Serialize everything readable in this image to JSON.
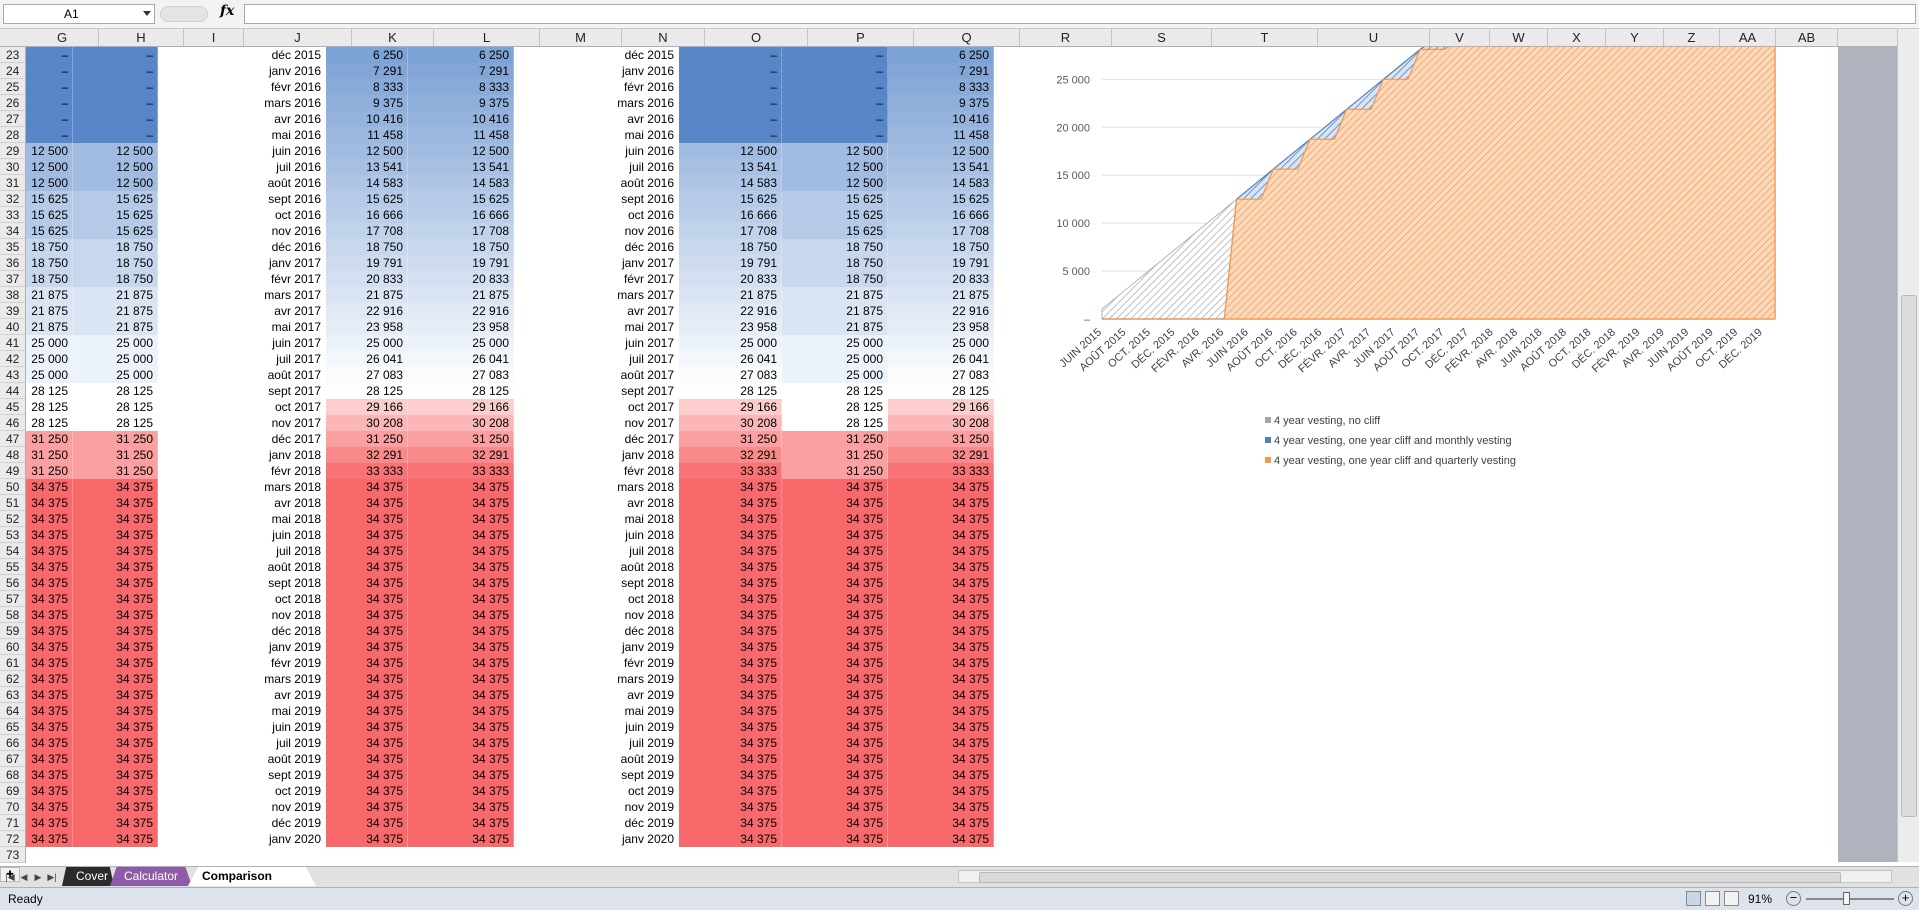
{
  "formula_bar": {
    "name_box": "A1",
    "fx_label": "fx",
    "content": ""
  },
  "columns": [
    "G",
    "H",
    "I",
    "J",
    "K",
    "L",
    "M",
    "N",
    "O",
    "P",
    "Q",
    "R",
    "S",
    "T",
    "U",
    "V",
    "W",
    "X",
    "Y",
    "Z",
    "AA",
    "AB"
  ],
  "rows": [
    {
      "r": "23",
      "j": "déc 2015",
      "k": "6 250",
      "o": "–",
      "p": "–",
      "q": "6 250",
      "g": "–",
      "h": "–"
    },
    {
      "r": "24",
      "j": "janv 2016",
      "k": "7 291",
      "o": "–",
      "p": "–",
      "q": "7 291",
      "g": "–",
      "h": "–"
    },
    {
      "r": "25",
      "j": "févr 2016",
      "k": "8 333",
      "o": "–",
      "p": "–",
      "q": "8 333",
      "g": "–",
      "h": "–"
    },
    {
      "r": "26",
      "j": "mars 2016",
      "k": "9 375",
      "o": "–",
      "p": "–",
      "q": "9 375",
      "g": "–",
      "h": "–"
    },
    {
      "r": "27",
      "j": "avr 2016",
      "k": "10 416",
      "o": "–",
      "p": "–",
      "q": "10 416",
      "g": "–",
      "h": "–"
    },
    {
      "r": "28",
      "j": "mai 2016",
      "k": "11 458",
      "o": "–",
      "p": "–",
      "q": "11 458",
      "g": "–",
      "h": "–"
    },
    {
      "r": "29",
      "j": "juin 2016",
      "k": "12 500",
      "o": "12 500",
      "p": "12 500",
      "q": "12 500",
      "g": "12 500",
      "h": "12 500"
    },
    {
      "r": "30",
      "j": "juil 2016",
      "k": "13 541",
      "o": "13 541",
      "p": "12 500",
      "q": "13 541",
      "g": "12 500",
      "h": "12 500"
    },
    {
      "r": "31",
      "j": "août 2016",
      "k": "14 583",
      "o": "14 583",
      "p": "12 500",
      "q": "14 583",
      "g": "12 500",
      "h": "12 500"
    },
    {
      "r": "32",
      "j": "sept 2016",
      "k": "15 625",
      "o": "15 625",
      "p": "15 625",
      "q": "15 625",
      "g": "15 625",
      "h": "15 625"
    },
    {
      "r": "33",
      "j": "oct 2016",
      "k": "16 666",
      "o": "16 666",
      "p": "15 625",
      "q": "16 666",
      "g": "15 625",
      "h": "15 625"
    },
    {
      "r": "34",
      "j": "nov 2016",
      "k": "17 708",
      "o": "17 708",
      "p": "15 625",
      "q": "17 708",
      "g": "15 625",
      "h": "15 625"
    },
    {
      "r": "35",
      "j": "déc 2016",
      "k": "18 750",
      "o": "18 750",
      "p": "18 750",
      "q": "18 750",
      "g": "18 750",
      "h": "18 750"
    },
    {
      "r": "36",
      "j": "janv 2017",
      "k": "19 791",
      "o": "19 791",
      "p": "18 750",
      "q": "19 791",
      "g": "18 750",
      "h": "18 750"
    },
    {
      "r": "37",
      "j": "févr 2017",
      "k": "20 833",
      "o": "20 833",
      "p": "18 750",
      "q": "20 833",
      "g": "18 750",
      "h": "18 750"
    },
    {
      "r": "38",
      "j": "mars 2017",
      "k": "21 875",
      "o": "21 875",
      "p": "21 875",
      "q": "21 875",
      "g": "21 875",
      "h": "21 875"
    },
    {
      "r": "39",
      "j": "avr 2017",
      "k": "22 916",
      "o": "22 916",
      "p": "21 875",
      "q": "22 916",
      "g": "21 875",
      "h": "21 875"
    },
    {
      "r": "40",
      "j": "mai 2017",
      "k": "23 958",
      "o": "23 958",
      "p": "21 875",
      "q": "23 958",
      "g": "21 875",
      "h": "21 875"
    },
    {
      "r": "41",
      "j": "juin 2017",
      "k": "25 000",
      "o": "25 000",
      "p": "25 000",
      "q": "25 000",
      "g": "25 000",
      "h": "25 000"
    },
    {
      "r": "42",
      "j": "juil 2017",
      "k": "26 041",
      "o": "26 041",
      "p": "25 000",
      "q": "26 041",
      "g": "25 000",
      "h": "25 000"
    },
    {
      "r": "43",
      "j": "août 2017",
      "k": "27 083",
      "o": "27 083",
      "p": "25 000",
      "q": "27 083",
      "g": "25 000",
      "h": "25 000"
    },
    {
      "r": "44",
      "j": "sept 2017",
      "k": "28 125",
      "o": "28 125",
      "p": "28 125",
      "q": "28 125",
      "g": "28 125",
      "h": "28 125"
    },
    {
      "r": "45",
      "j": "oct 2017",
      "k": "29 166",
      "o": "29 166",
      "p": "28 125",
      "q": "29 166",
      "g": "28 125",
      "h": "28 125"
    },
    {
      "r": "46",
      "j": "nov 2017",
      "k": "30 208",
      "o": "30 208",
      "p": "28 125",
      "q": "30 208",
      "g": "28 125",
      "h": "28 125"
    },
    {
      "r": "47",
      "j": "déc 2017",
      "k": "31 250",
      "o": "31 250",
      "p": "31 250",
      "q": "31 250",
      "g": "31 250",
      "h": "31 250"
    },
    {
      "r": "48",
      "j": "janv 2018",
      "k": "32 291",
      "o": "32 291",
      "p": "31 250",
      "q": "32 291",
      "g": "31 250",
      "h": "31 250"
    },
    {
      "r": "49",
      "j": "févr 2018",
      "k": "33 333",
      "o": "33 333",
      "p": "31 250",
      "q": "33 333",
      "g": "31 250",
      "h": "31 250"
    },
    {
      "r": "50",
      "j": "mars 2018",
      "k": "34 375",
      "o": "34 375",
      "p": "34 375",
      "q": "34 375",
      "g": "34 375",
      "h": "34 375"
    },
    {
      "r": "51",
      "j": "avr 2018",
      "k": "34 375",
      "o": "34 375",
      "p": "34 375",
      "q": "34 375",
      "g": "34 375",
      "h": "34 375"
    },
    {
      "r": "52",
      "j": "mai 2018",
      "k": "34 375",
      "o": "34 375",
      "p": "34 375",
      "q": "34 375",
      "g": "34 375",
      "h": "34 375"
    },
    {
      "r": "53",
      "j": "juin 2018",
      "k": "34 375",
      "o": "34 375",
      "p": "34 375",
      "q": "34 375",
      "g": "34 375",
      "h": "34 375"
    },
    {
      "r": "54",
      "j": "juil 2018",
      "k": "34 375",
      "o": "34 375",
      "p": "34 375",
      "q": "34 375",
      "g": "34 375",
      "h": "34 375"
    },
    {
      "r": "55",
      "j": "août 2018",
      "k": "34 375",
      "o": "34 375",
      "p": "34 375",
      "q": "34 375",
      "g": "34 375",
      "h": "34 375"
    },
    {
      "r": "56",
      "j": "sept 2018",
      "k": "34 375",
      "o": "34 375",
      "p": "34 375",
      "q": "34 375",
      "g": "34 375",
      "h": "34 375"
    },
    {
      "r": "57",
      "j": "oct 2018",
      "k": "34 375",
      "o": "34 375",
      "p": "34 375",
      "q": "34 375",
      "g": "34 375",
      "h": "34 375"
    },
    {
      "r": "58",
      "j": "nov 2018",
      "k": "34 375",
      "o": "34 375",
      "p": "34 375",
      "q": "34 375",
      "g": "34 375",
      "h": "34 375"
    },
    {
      "r": "59",
      "j": "déc 2018",
      "k": "34 375",
      "o": "34 375",
      "p": "34 375",
      "q": "34 375",
      "g": "34 375",
      "h": "34 375"
    },
    {
      "r": "60",
      "j": "janv 2019",
      "k": "34 375",
      "o": "34 375",
      "p": "34 375",
      "q": "34 375",
      "g": "34 375",
      "h": "34 375"
    },
    {
      "r": "61",
      "j": "févr 2019",
      "k": "34 375",
      "o": "34 375",
      "p": "34 375",
      "q": "34 375",
      "g": "34 375",
      "h": "34 375"
    },
    {
      "r": "62",
      "j": "mars 2019",
      "k": "34 375",
      "o": "34 375",
      "p": "34 375",
      "q": "34 375",
      "g": "34 375",
      "h": "34 375"
    },
    {
      "r": "63",
      "j": "avr 2019",
      "k": "34 375",
      "o": "34 375",
      "p": "34 375",
      "q": "34 375",
      "g": "34 375",
      "h": "34 375"
    },
    {
      "r": "64",
      "j": "mai 2019",
      "k": "34 375",
      "o": "34 375",
      "p": "34 375",
      "q": "34 375",
      "g": "34 375",
      "h": "34 375"
    },
    {
      "r": "65",
      "j": "juin 2019",
      "k": "34 375",
      "o": "34 375",
      "p": "34 375",
      "q": "34 375",
      "g": "34 375",
      "h": "34 375"
    },
    {
      "r": "66",
      "j": "juil 2019",
      "k": "34 375",
      "o": "34 375",
      "p": "34 375",
      "q": "34 375",
      "g": "34 375",
      "h": "34 375"
    },
    {
      "r": "67",
      "j": "août 2019",
      "k": "34 375",
      "o": "34 375",
      "p": "34 375",
      "q": "34 375",
      "g": "34 375",
      "h": "34 375"
    },
    {
      "r": "68",
      "j": "sept 2019",
      "k": "34 375",
      "o": "34 375",
      "p": "34 375",
      "q": "34 375",
      "g": "34 375",
      "h": "34 375"
    },
    {
      "r": "69",
      "j": "oct 2019",
      "k": "34 375",
      "o": "34 375",
      "p": "34 375",
      "q": "34 375",
      "g": "34 375",
      "h": "34 375"
    },
    {
      "r": "70",
      "j": "nov 2019",
      "k": "34 375",
      "o": "34 375",
      "p": "34 375",
      "q": "34 375",
      "g": "34 375",
      "h": "34 375"
    },
    {
      "r": "71",
      "j": "déc 2019",
      "k": "34 375",
      "o": "34 375",
      "p": "34 375",
      "q": "34 375",
      "g": "34 375",
      "h": "34 375"
    },
    {
      "r": "72",
      "j": "janv 2020",
      "k": "34 375",
      "o": "34 375",
      "p": "34 375",
      "q": "34 375",
      "g": "34 375",
      "h": "34 375"
    },
    {
      "r": "73",
      "j": "",
      "k": "",
      "o": "",
      "p": "",
      "q": "",
      "g": "",
      "h": ""
    }
  ],
  "scale_colors": {
    "blue_dark": "#5887c9",
    "blue_light": "#e9eef8",
    "white": "#ffffff",
    "red_light": "#fde3e3",
    "red_dark": "#f8696b"
  },
  "chart_data": {
    "type": "area",
    "y_ticks": [
      "–",
      "5 000",
      "10 000",
      "15 000",
      "20 000",
      "25 000"
    ],
    "ylim": [
      0,
      29000
    ],
    "x_tick_labels": [
      "JUIN 2015",
      "AOÛT 2015",
      "OCT. 2015",
      "DÉC. 2015",
      "FÉVR. 2016",
      "AVR. 2016",
      "JUIN 2016",
      "AOÛT 2016",
      "OCT. 2016",
      "DÉC. 2016",
      "FÉVR. 2017",
      "AVR. 2017",
      "JUIN 2017",
      "AOÛT 2017",
      "OCT. 2017",
      "DÉC. 2017",
      "FÉVR. 2018",
      "AVR. 2018",
      "JUIN 2018",
      "AOÛT 2018",
      "OCT. 2018",
      "DÉC. 2018",
      "FÉVR. 2019",
      "AVR. 2019",
      "JUIN 2019",
      "AOÛT 2019",
      "OCT. 2019",
      "DÉC. 2019"
    ],
    "x_months": [
      "2015-06",
      "2015-07",
      "2015-08",
      "2015-09",
      "2015-10",
      "2015-11",
      "2015-12",
      "2016-01",
      "2016-02",
      "2016-03",
      "2016-04",
      "2016-05",
      "2016-06",
      "2016-07",
      "2016-08",
      "2016-09",
      "2016-10",
      "2016-11",
      "2016-12",
      "2017-01",
      "2017-02",
      "2017-03",
      "2017-04",
      "2017-05",
      "2017-06",
      "2017-07",
      "2017-08",
      "2017-09",
      "2017-10",
      "2017-11",
      "2017-12",
      "2018-01",
      "2018-02",
      "2018-03",
      "2018-04",
      "2018-05",
      "2018-06",
      "2018-07",
      "2018-08",
      "2018-09",
      "2018-10",
      "2018-11",
      "2018-12",
      "2019-01",
      "2019-02",
      "2019-03",
      "2019-04",
      "2019-05",
      "2019-06",
      "2019-07",
      "2019-08",
      "2019-09",
      "2019-10",
      "2019-11",
      "2019-12",
      "2020-01"
    ],
    "series": [
      {
        "name": "4 year vesting, no cliff",
        "color": "#a5a5a5",
        "values": [
          1041,
          2083,
          3125,
          4166,
          5208,
          6250,
          7291,
          8333,
          9375,
          10416,
          11458,
          12500,
          13541,
          14583,
          15625,
          16666,
          17708,
          18750,
          19791,
          20833,
          21875,
          22916,
          23958,
          25000,
          26041,
          27083,
          28125,
          29166,
          30208,
          31250,
          32291,
          33333,
          34375,
          34375,
          34375,
          34375,
          34375,
          34375,
          34375,
          34375,
          34375,
          34375,
          34375,
          34375,
          34375,
          34375,
          34375,
          34375,
          34375,
          34375,
          34375,
          34375,
          34375,
          34375,
          34375,
          34375
        ]
      },
      {
        "name": "4 year vesting, one year cliff and monthly vesting",
        "color": "#4f81bd",
        "values": [
          0,
          0,
          0,
          0,
          0,
          0,
          0,
          0,
          0,
          0,
          0,
          12500,
          13541,
          14583,
          15625,
          16666,
          17708,
          18750,
          19791,
          20833,
          21875,
          22916,
          23958,
          25000,
          26041,
          27083,
          28125,
          29166,
          30208,
          31250,
          32291,
          33333,
          34375,
          34375,
          34375,
          34375,
          34375,
          34375,
          34375,
          34375,
          34375,
          34375,
          34375,
          34375,
          34375,
          34375,
          34375,
          34375,
          34375,
          34375,
          34375,
          34375,
          34375,
          34375,
          34375,
          34375
        ]
      },
      {
        "name": "4 year vesting, one year cliff and quarterly vesting",
        "color": "#f79646",
        "values": [
          0,
          0,
          0,
          0,
          0,
          0,
          0,
          0,
          0,
          0,
          0,
          12500,
          12500,
          12500,
          15625,
          15625,
          15625,
          18750,
          18750,
          18750,
          21875,
          21875,
          21875,
          25000,
          25000,
          25000,
          28125,
          28125,
          28125,
          31250,
          31250,
          31250,
          34375,
          34375,
          34375,
          34375,
          34375,
          34375,
          34375,
          34375,
          34375,
          34375,
          34375,
          34375,
          34375,
          34375,
          34375,
          34375,
          34375,
          34375,
          34375,
          34375,
          34375,
          34375,
          34375,
          34375
        ]
      }
    ]
  },
  "sheet_tabs": [
    "Cover",
    "Calculator",
    "Comparison Chart"
  ],
  "status": {
    "text": "Ready",
    "zoom": "91%"
  }
}
